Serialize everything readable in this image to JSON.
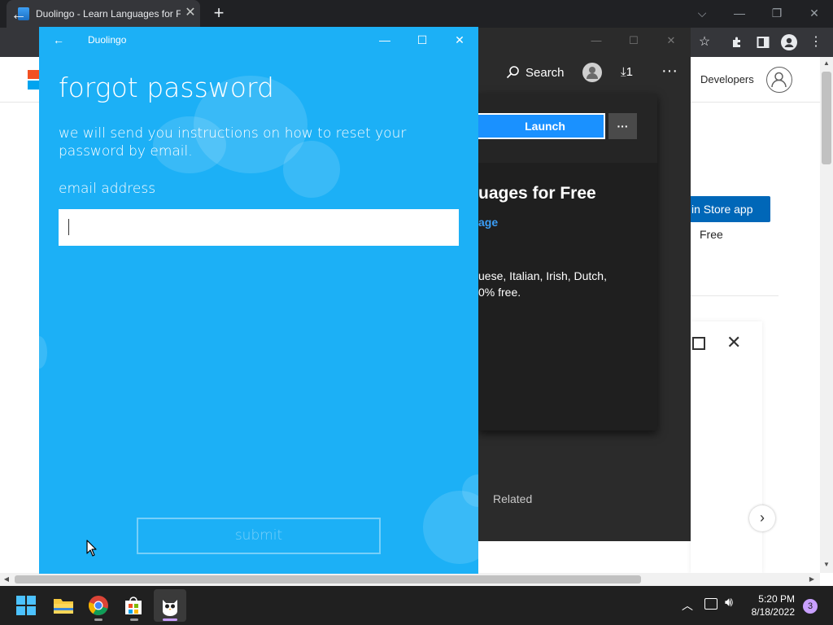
{
  "browser": {
    "tab_title": "Duolingo - Learn Languages for Free",
    "tab_close": "✕",
    "new_tab": "+",
    "minimize": "⌵",
    "minimize2": "—",
    "restore": "❐",
    "close": "✕"
  },
  "page": {
    "developers_link": "Developers",
    "store_button": "in Store app",
    "price": "Free",
    "card_close": "✕"
  },
  "store_window": {
    "search_label": "Search",
    "download_count": "1",
    "more": "···",
    "launch_button": "Launch",
    "launch_more": "···",
    "app_title_visible": "uages for Free",
    "app_subtitle_visible": "age",
    "description_line1_visible": "uese, Italian, Irish, Dutch,",
    "description_line2_visible": "0% free.",
    "related": "Related"
  },
  "duolingo": {
    "app_name": "Duolingo",
    "heading": "forgot password",
    "instructions": "we will send you instructions on how to reset your password by email.",
    "email_label": "email address",
    "email_value": "",
    "submit_label": "submit",
    "bg_color": "#1cb0f6"
  },
  "taskbar": {
    "clock_time": "5:20 PM",
    "clock_date": "8/18/2022",
    "notification_count": "3"
  }
}
